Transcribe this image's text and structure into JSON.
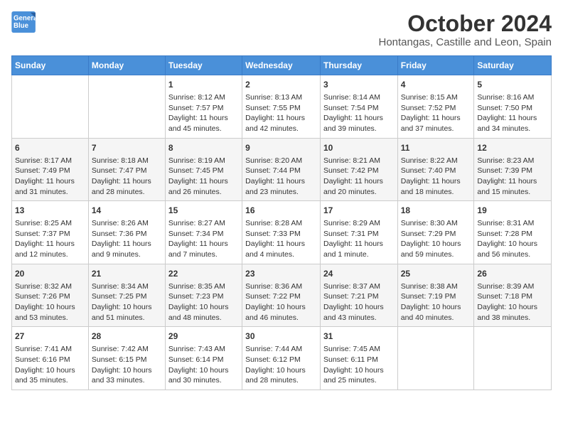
{
  "header": {
    "logo_line1": "General",
    "logo_line2": "Blue",
    "title": "October 2024",
    "subtitle": "Hontangas, Castille and Leon, Spain"
  },
  "columns": [
    "Sunday",
    "Monday",
    "Tuesday",
    "Wednesday",
    "Thursday",
    "Friday",
    "Saturday"
  ],
  "weeks": [
    [
      {
        "day": "",
        "text": ""
      },
      {
        "day": "",
        "text": ""
      },
      {
        "day": "1",
        "text": "Sunrise: 8:12 AM\nSunset: 7:57 PM\nDaylight: 11 hours and 45 minutes."
      },
      {
        "day": "2",
        "text": "Sunrise: 8:13 AM\nSunset: 7:55 PM\nDaylight: 11 hours and 42 minutes."
      },
      {
        "day": "3",
        "text": "Sunrise: 8:14 AM\nSunset: 7:54 PM\nDaylight: 11 hours and 39 minutes."
      },
      {
        "day": "4",
        "text": "Sunrise: 8:15 AM\nSunset: 7:52 PM\nDaylight: 11 hours and 37 minutes."
      },
      {
        "day": "5",
        "text": "Sunrise: 8:16 AM\nSunset: 7:50 PM\nDaylight: 11 hours and 34 minutes."
      }
    ],
    [
      {
        "day": "6",
        "text": "Sunrise: 8:17 AM\nSunset: 7:49 PM\nDaylight: 11 hours and 31 minutes."
      },
      {
        "day": "7",
        "text": "Sunrise: 8:18 AM\nSunset: 7:47 PM\nDaylight: 11 hours and 28 minutes."
      },
      {
        "day": "8",
        "text": "Sunrise: 8:19 AM\nSunset: 7:45 PM\nDaylight: 11 hours and 26 minutes."
      },
      {
        "day": "9",
        "text": "Sunrise: 8:20 AM\nSunset: 7:44 PM\nDaylight: 11 hours and 23 minutes."
      },
      {
        "day": "10",
        "text": "Sunrise: 8:21 AM\nSunset: 7:42 PM\nDaylight: 11 hours and 20 minutes."
      },
      {
        "day": "11",
        "text": "Sunrise: 8:22 AM\nSunset: 7:40 PM\nDaylight: 11 hours and 18 minutes."
      },
      {
        "day": "12",
        "text": "Sunrise: 8:23 AM\nSunset: 7:39 PM\nDaylight: 11 hours and 15 minutes."
      }
    ],
    [
      {
        "day": "13",
        "text": "Sunrise: 8:25 AM\nSunset: 7:37 PM\nDaylight: 11 hours and 12 minutes."
      },
      {
        "day": "14",
        "text": "Sunrise: 8:26 AM\nSunset: 7:36 PM\nDaylight: 11 hours and 9 minutes."
      },
      {
        "day": "15",
        "text": "Sunrise: 8:27 AM\nSunset: 7:34 PM\nDaylight: 11 hours and 7 minutes."
      },
      {
        "day": "16",
        "text": "Sunrise: 8:28 AM\nSunset: 7:33 PM\nDaylight: 11 hours and 4 minutes."
      },
      {
        "day": "17",
        "text": "Sunrise: 8:29 AM\nSunset: 7:31 PM\nDaylight: 11 hours and 1 minute."
      },
      {
        "day": "18",
        "text": "Sunrise: 8:30 AM\nSunset: 7:29 PM\nDaylight: 10 hours and 59 minutes."
      },
      {
        "day": "19",
        "text": "Sunrise: 8:31 AM\nSunset: 7:28 PM\nDaylight: 10 hours and 56 minutes."
      }
    ],
    [
      {
        "day": "20",
        "text": "Sunrise: 8:32 AM\nSunset: 7:26 PM\nDaylight: 10 hours and 53 minutes."
      },
      {
        "day": "21",
        "text": "Sunrise: 8:34 AM\nSunset: 7:25 PM\nDaylight: 10 hours and 51 minutes."
      },
      {
        "day": "22",
        "text": "Sunrise: 8:35 AM\nSunset: 7:23 PM\nDaylight: 10 hours and 48 minutes."
      },
      {
        "day": "23",
        "text": "Sunrise: 8:36 AM\nSunset: 7:22 PM\nDaylight: 10 hours and 46 minutes."
      },
      {
        "day": "24",
        "text": "Sunrise: 8:37 AM\nSunset: 7:21 PM\nDaylight: 10 hours and 43 minutes."
      },
      {
        "day": "25",
        "text": "Sunrise: 8:38 AM\nSunset: 7:19 PM\nDaylight: 10 hours and 40 minutes."
      },
      {
        "day": "26",
        "text": "Sunrise: 8:39 AM\nSunset: 7:18 PM\nDaylight: 10 hours and 38 minutes."
      }
    ],
    [
      {
        "day": "27",
        "text": "Sunrise: 7:41 AM\nSunset: 6:16 PM\nDaylight: 10 hours and 35 minutes."
      },
      {
        "day": "28",
        "text": "Sunrise: 7:42 AM\nSunset: 6:15 PM\nDaylight: 10 hours and 33 minutes."
      },
      {
        "day": "29",
        "text": "Sunrise: 7:43 AM\nSunset: 6:14 PM\nDaylight: 10 hours and 30 minutes."
      },
      {
        "day": "30",
        "text": "Sunrise: 7:44 AM\nSunset: 6:12 PM\nDaylight: 10 hours and 28 minutes."
      },
      {
        "day": "31",
        "text": "Sunrise: 7:45 AM\nSunset: 6:11 PM\nDaylight: 10 hours and 25 minutes."
      },
      {
        "day": "",
        "text": ""
      },
      {
        "day": "",
        "text": ""
      }
    ]
  ]
}
